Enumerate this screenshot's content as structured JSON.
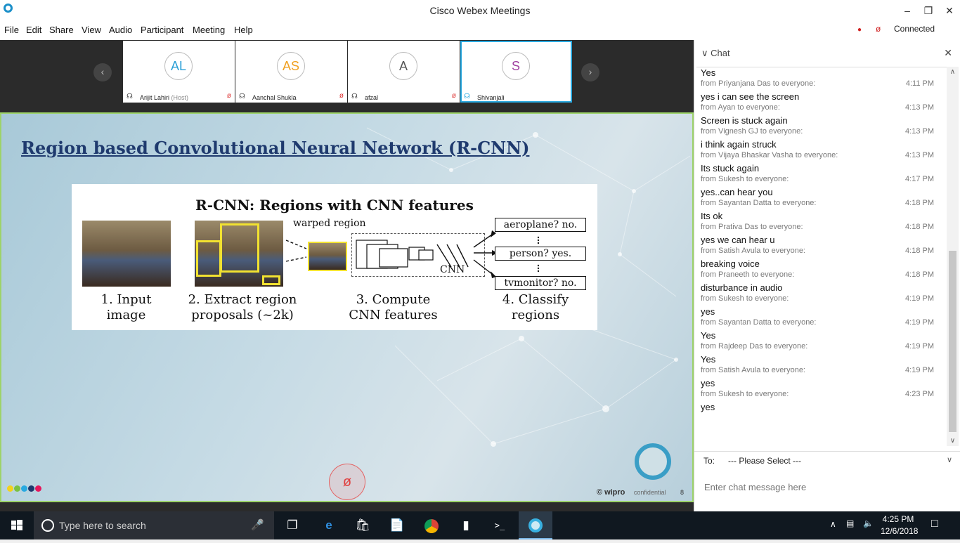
{
  "window": {
    "title": "Cisco Webex Meetings",
    "status": "Connected"
  },
  "menu": [
    "File",
    "Edit",
    "Share",
    "View",
    "Audio",
    "Participant",
    "Meeting",
    "Help"
  ],
  "participants": [
    {
      "initials": "AL",
      "name": "Arijit Lahiri",
      "role": "(Host)",
      "color": "#2a9fd6"
    },
    {
      "initials": "AS",
      "name": "Aanchal Shukla",
      "role": "",
      "color": "#f0a020"
    },
    {
      "initials": "A",
      "name": "afzal",
      "role": "",
      "color": "#555555"
    },
    {
      "initials": "S",
      "name": "Shivanjali",
      "role": "",
      "color": "#a040a0"
    }
  ],
  "slide": {
    "title": "Region based Convolutional Neural Network (R-CNN)",
    "figure_title": "R-CNN: Regions with CNN features",
    "warped": "warped region",
    "cnn": "CNN",
    "steps": [
      "1. Input\nimage",
      "2. Extract region\nproposals (~2k)",
      "3. Compute\nCNN features",
      "4. Classify\nregions"
    ],
    "outputs": [
      "aeroplane? no.",
      "person? yes.",
      "tvmonitor? no."
    ],
    "footer_brand": "© wipro",
    "footer_conf": "confidential",
    "footer_page": "8"
  },
  "chat": {
    "header": "Chat",
    "messages": [
      {
        "meta": "",
        "time": "",
        "text": "Yes"
      },
      {
        "meta": "from Priyanjana Das to everyone:",
        "time": "4:11 PM",
        "text": "yes i can see the screen"
      },
      {
        "meta": "from Ayan to everyone:",
        "time": "4:13 PM",
        "text": "Screen is stuck again"
      },
      {
        "meta": "from Vignesh GJ to everyone:",
        "time": "4:13 PM",
        "text": "i think again struck"
      },
      {
        "meta": "from Vijaya Bhaskar Vasha to everyone:",
        "time": "4:13 PM",
        "text": "Its stuck again"
      },
      {
        "meta": "from Sukesh to everyone:",
        "time": "4:17 PM",
        "text": "yes..can hear you"
      },
      {
        "meta": "from Sayantan Datta to everyone:",
        "time": "4:18 PM",
        "text": "Its ok"
      },
      {
        "meta": "from Prativa Das to everyone:",
        "time": "4:18 PM",
        "text": "yes we can hear u"
      },
      {
        "meta": "from Satish Avula to everyone:",
        "time": "4:18 PM",
        "text": "breaking voice"
      },
      {
        "meta": "from Praneeth to everyone:",
        "time": "4:18 PM",
        "text": "disturbance in audio"
      },
      {
        "meta": "from Sukesh to everyone:",
        "time": "4:19 PM",
        "text": "yes"
      },
      {
        "meta": "from Sayantan Datta to everyone:",
        "time": "4:19 PM",
        "text": "Yes"
      },
      {
        "meta": "from Rajdeep Das to everyone:",
        "time": "4:19 PM",
        "text": "Yes"
      },
      {
        "meta": "from Satish Avula to everyone:",
        "time": "4:19 PM",
        "text": "yes"
      },
      {
        "meta": "from Sukesh to everyone:",
        "time": "4:23 PM",
        "text": "yes"
      }
    ],
    "to_label": "To:",
    "to_value": "--- Please Select ---",
    "input_placeholder": "Enter chat message here"
  },
  "taskbar": {
    "search_placeholder": "Type here to search",
    "time": "4:25 PM",
    "date": "12/6/2018"
  }
}
